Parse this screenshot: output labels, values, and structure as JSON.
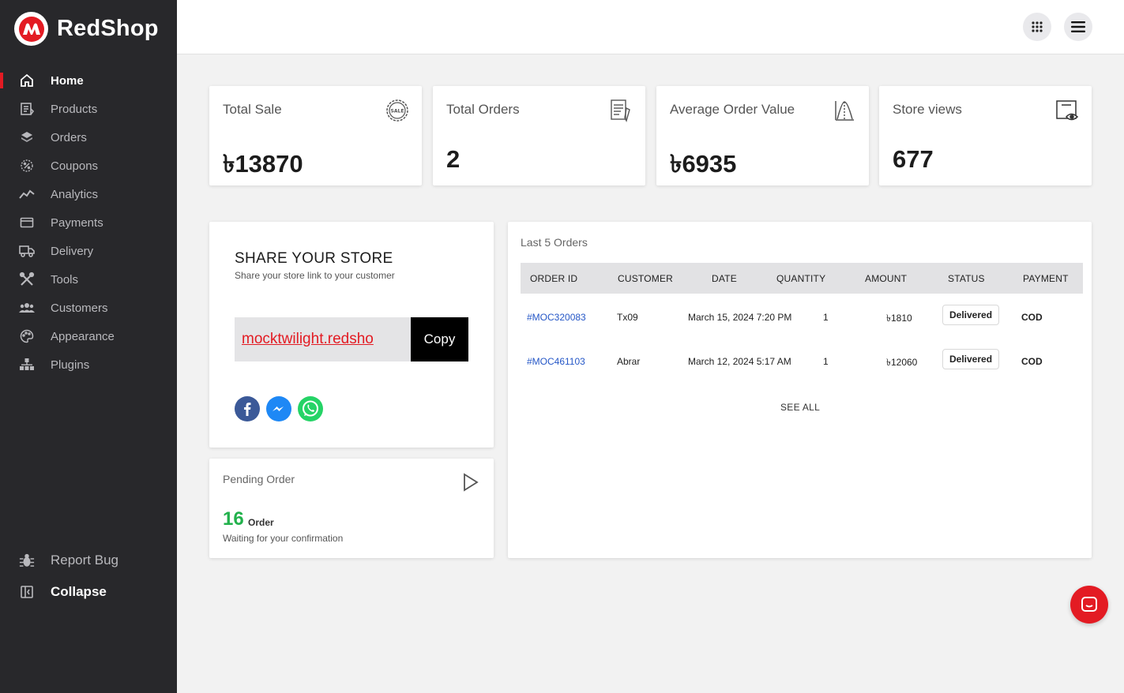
{
  "brand": {
    "name": "RedShop"
  },
  "sidebar": {
    "items": [
      {
        "label": "Home",
        "icon": "home-icon"
      },
      {
        "label": "Products",
        "icon": "products-icon"
      },
      {
        "label": "Orders",
        "icon": "layers-icon"
      },
      {
        "label": "Coupons",
        "icon": "coupon-icon"
      },
      {
        "label": "Analytics",
        "icon": "analytics-icon"
      },
      {
        "label": "Payments",
        "icon": "card-icon"
      },
      {
        "label": "Delivery",
        "icon": "truck-icon"
      },
      {
        "label": "Tools",
        "icon": "tools-icon"
      },
      {
        "label": "Customers",
        "icon": "customers-icon"
      },
      {
        "label": "Appearance",
        "icon": "palette-icon"
      },
      {
        "label": "Plugins",
        "icon": "plugins-icon"
      }
    ],
    "active": "Home",
    "report_bug": "Report Bug",
    "collapse": "Collapse"
  },
  "stats": [
    {
      "title": "Total Sale",
      "value": "৳13870",
      "icon": "sale-badge-icon"
    },
    {
      "title": "Total Orders",
      "value": "2",
      "icon": "order-list-icon"
    },
    {
      "title": "Average Order Value",
      "value": "৳6935",
      "icon": "bell-curve-icon"
    },
    {
      "title": "Store views",
      "value": "677",
      "icon": "view-icon"
    }
  ],
  "share": {
    "title": "SHARE YOUR STORE",
    "subtitle": "Share your store link to your customer",
    "link": "mocktwilight.redsho",
    "copy_label": "Copy"
  },
  "pending": {
    "title": "Pending Order",
    "count": "16",
    "unit": "Order",
    "subtitle": "Waiting for your confirmation"
  },
  "orders": {
    "title": "Last 5 Orders",
    "columns": [
      "ORDER ID",
      "CUSTOMER",
      "DATE",
      "QUANTITY",
      "AMOUNT",
      "STATUS",
      "PAYMENT"
    ],
    "rows": [
      {
        "id": "#MOC320083",
        "customer": "Tx09",
        "date": "March 15, 2024 7:20 PM",
        "quantity": "1",
        "amount": "৳1810",
        "status": "Delivered",
        "payment": "COD"
      },
      {
        "id": "#MOC461103",
        "customer": "Abrar",
        "date": "March 12, 2024 5:17 AM",
        "quantity": "1",
        "amount": "৳12060",
        "status": "Delivered",
        "payment": "COD"
      }
    ],
    "see_all": "SEE ALL"
  },
  "colors": {
    "accent": "#e31b23",
    "sidebar_bg": "#28282b",
    "link": "#2557c7",
    "success": "#22b14c"
  }
}
